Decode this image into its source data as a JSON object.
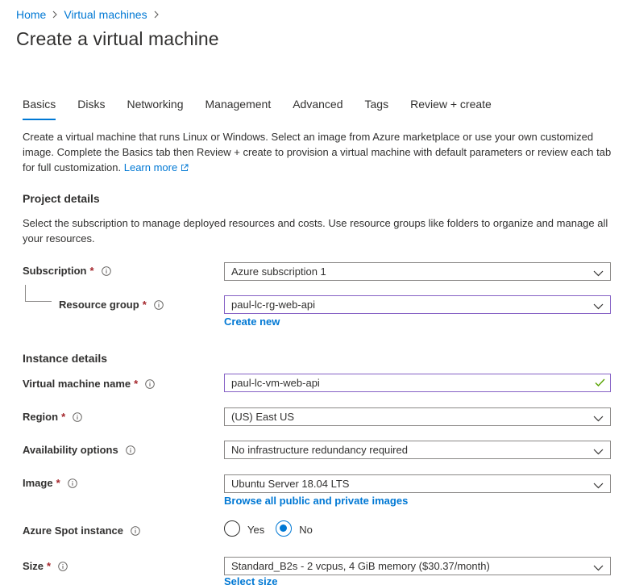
{
  "breadcrumb": {
    "home": "Home",
    "virtual_machines": "Virtual machines"
  },
  "page": {
    "title": "Create a virtual machine"
  },
  "tabs": [
    {
      "label": "Basics",
      "active": true
    },
    {
      "label": "Disks"
    },
    {
      "label": "Networking"
    },
    {
      "label": "Management"
    },
    {
      "label": "Advanced"
    },
    {
      "label": "Tags"
    },
    {
      "label": "Review + create"
    }
  ],
  "intro": {
    "text": "Create a virtual machine that runs Linux or Windows. Select an image from Azure marketplace or use your own customized image. Complete the Basics tab then Review + create to provision a virtual machine with default parameters or review each tab for full customization.",
    "learn_more": "Learn more"
  },
  "project_details": {
    "heading": "Project details",
    "description": "Select the subscription to manage deployed resources and costs. Use resource groups like folders to organize and manage all your resources.",
    "subscription": {
      "label": "Subscription",
      "required": "*",
      "value": "Azure subscription 1"
    },
    "resource_group": {
      "label": "Resource group",
      "required": "*",
      "value": "paul-lc-rg-web-api",
      "create_new": "Create new"
    }
  },
  "instance_details": {
    "heading": "Instance details",
    "vm_name": {
      "label": "Virtual machine name",
      "required": "*",
      "value": "paul-lc-vm-web-api"
    },
    "region": {
      "label": "Region",
      "required": "*",
      "value": "(US) East US"
    },
    "availability": {
      "label": "Availability options",
      "value": "No infrastructure redundancy required"
    },
    "image": {
      "label": "Image",
      "required": "*",
      "value": "Ubuntu Server 18.04 LTS",
      "browse_link": "Browse all public and private images"
    },
    "spot": {
      "label": "Azure Spot instance",
      "yes": "Yes",
      "no": "No",
      "selected": "No"
    },
    "size": {
      "label": "Size",
      "required": "*",
      "value": "Standard_B2s - 2 vcpus, 4 GiB memory ($30.37/month)",
      "select_link": "Select size"
    }
  },
  "colors": {
    "accent": "#0078d4",
    "required": "#a4262c",
    "focus_border": "#8661c5",
    "valid_check": "#57a300"
  }
}
